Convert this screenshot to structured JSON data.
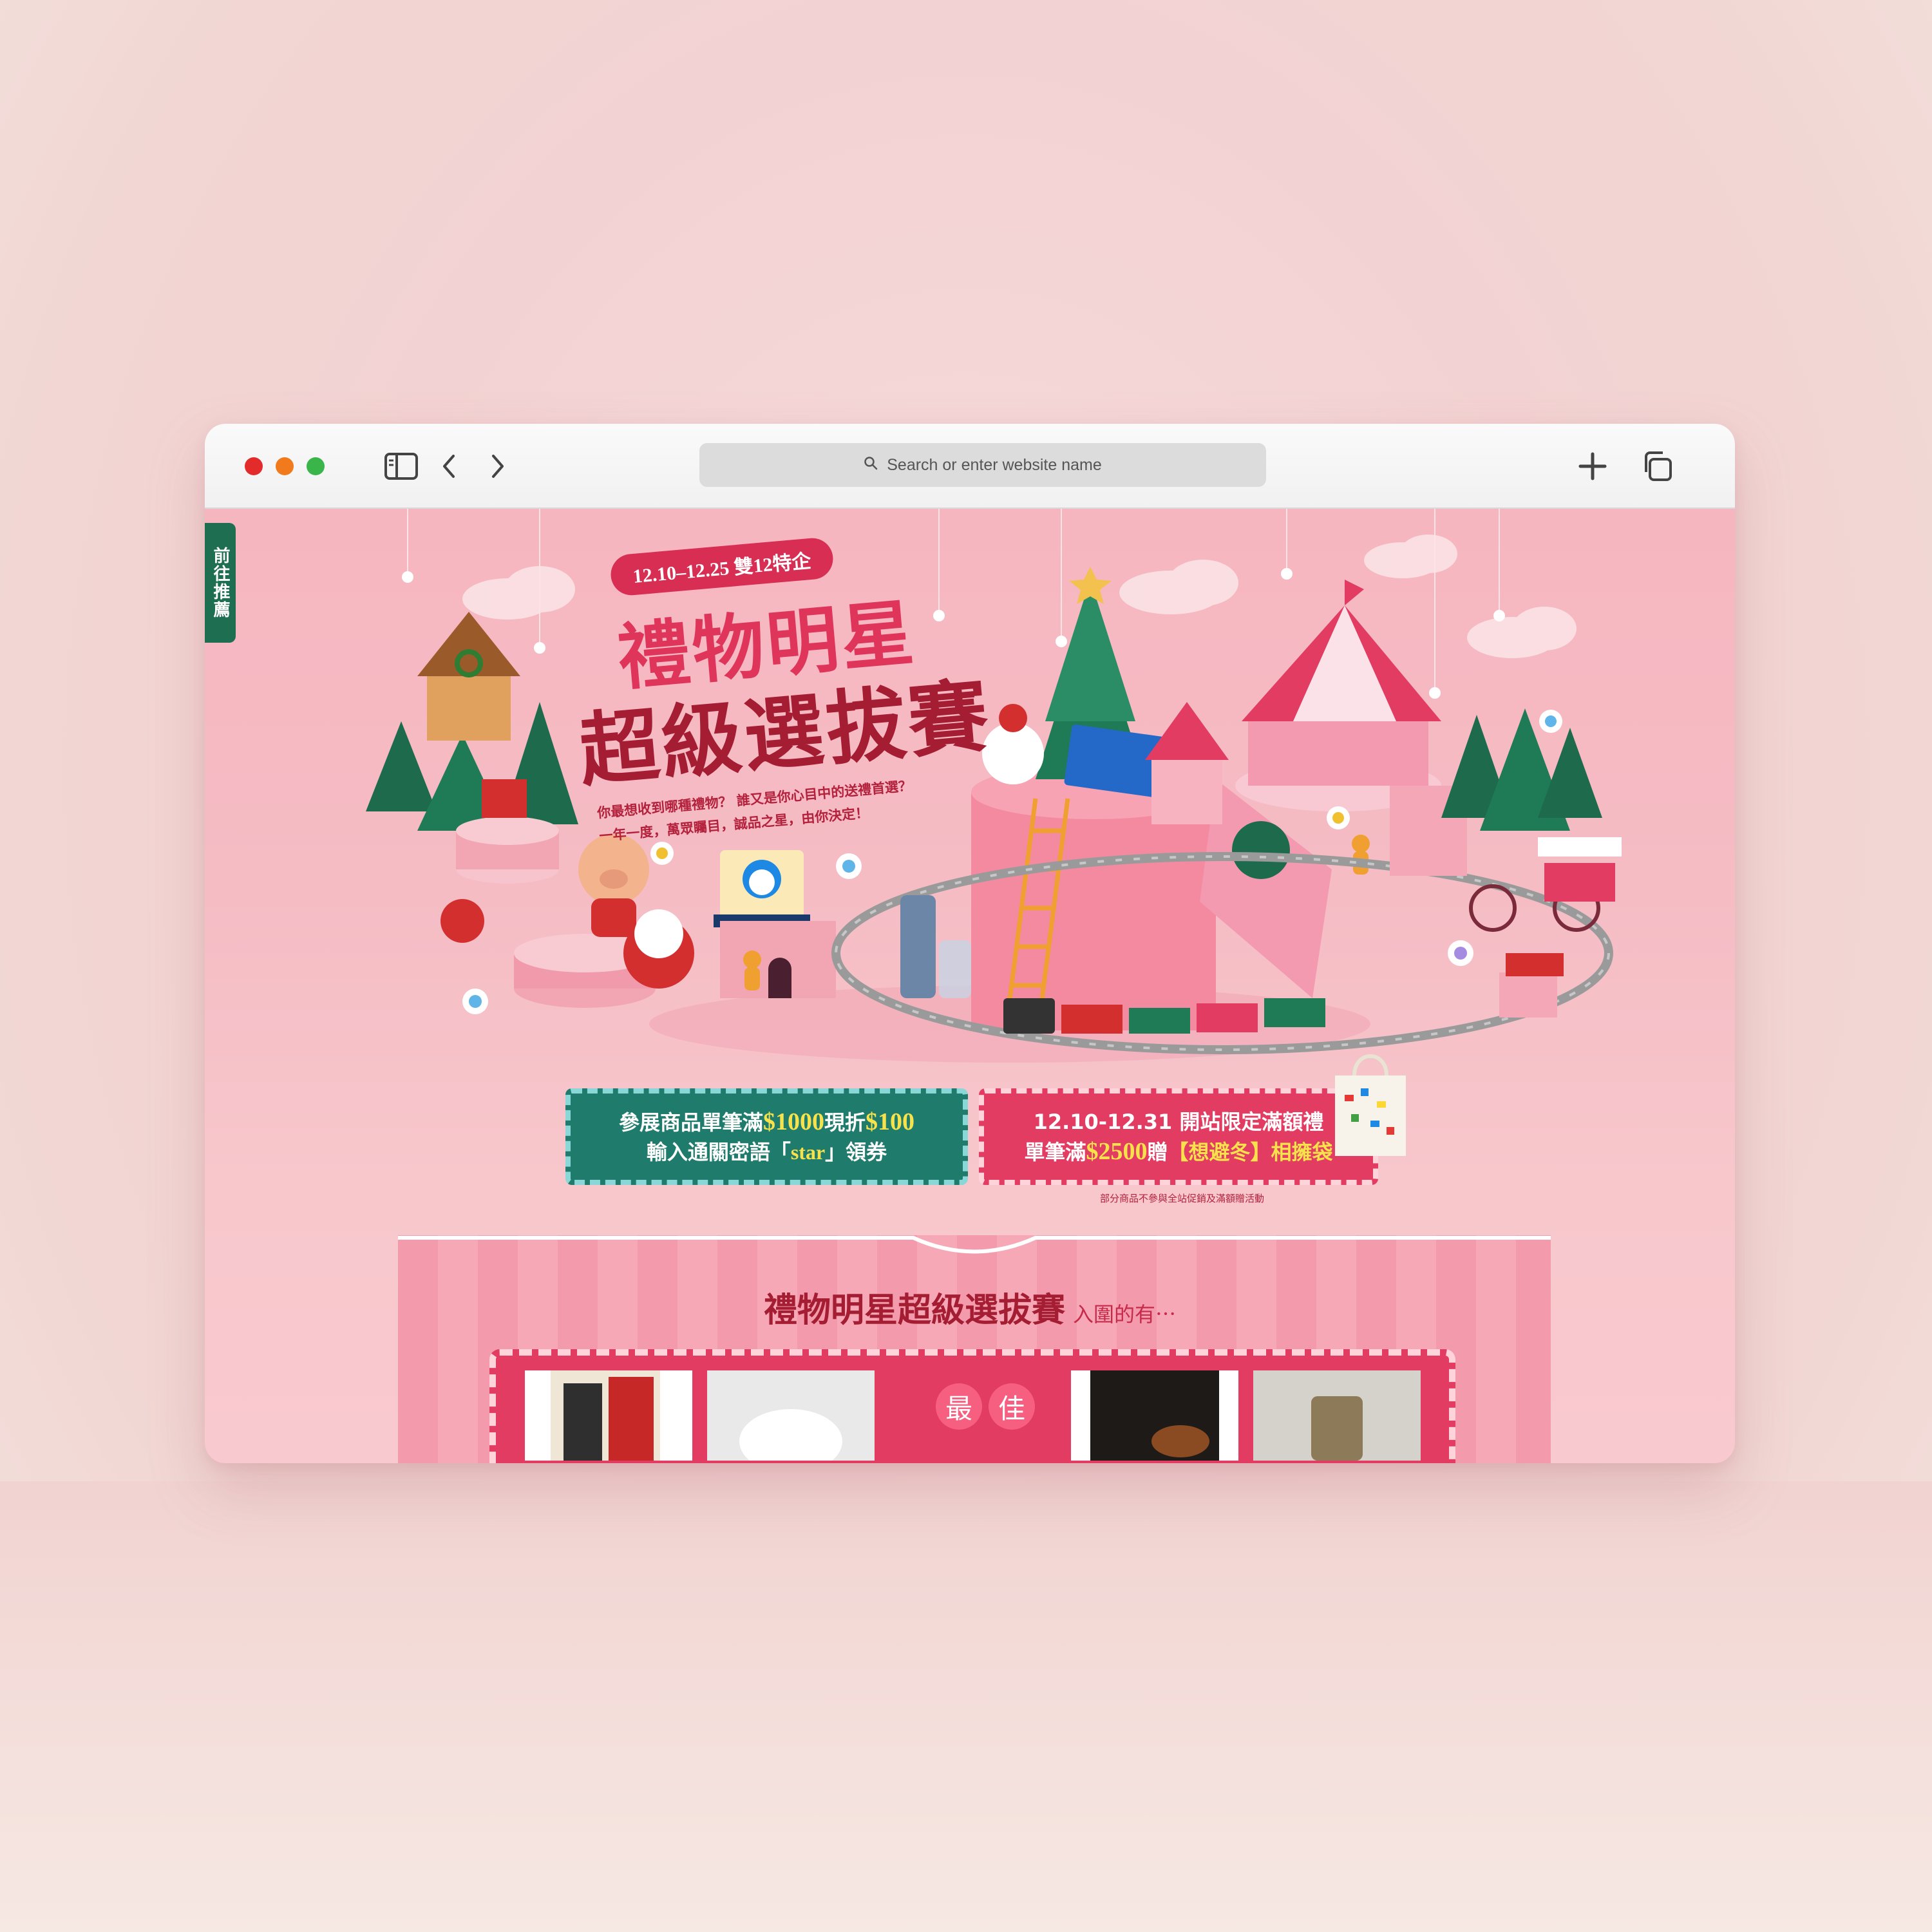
{
  "browser": {
    "search_placeholder": "Search or enter website name"
  },
  "side_tab": {
    "label": "前往推薦"
  },
  "hero": {
    "date_badge": "12.10–12.25 雙12特企",
    "title_line1": "禮物明星",
    "title_line2": "超級選拔賽",
    "desc_line1": "你最想收到哪種禮物？ 誰又是你心目中的送禮首選？",
    "desc_line2": "一年一度，萬眾矚目，誠品之星，由你決定！"
  },
  "promos": {
    "left_line1_a": "參展商品單筆滿",
    "left_line1_amount1": "$1000",
    "left_line1_b": "現折",
    "left_line1_amount2": "$100",
    "left_line2_a": "輸入通關密語「",
    "left_line2_code": "star",
    "left_line2_b": "」領券",
    "right_line1": "12.10-12.31 開站限定滿額禮",
    "right_line2_a": "單筆滿",
    "right_line2_amount": "$2500",
    "right_line2_b": "贈",
    "right_line2_gift": "【想避冬】相擁袋",
    "disclaimer": "部分商品不參與全站促銷及滿額贈活動"
  },
  "section": {
    "title": "禮物明星超級選拔賽",
    "subtitle": "入圍的有⋯",
    "best_chars": [
      "最",
      "佳"
    ]
  },
  "colors": {
    "brand_red": "#e0355b",
    "dark_red": "#a51d32",
    "green": "#1f7b6b",
    "pink_bg": "#f6b6c0"
  },
  "icons": [
    "sidebar-toggle-icon",
    "back-arrow-icon",
    "forward-arrow-icon",
    "search-icon",
    "new-tab-plus-icon",
    "tabs-overview-icon"
  ]
}
